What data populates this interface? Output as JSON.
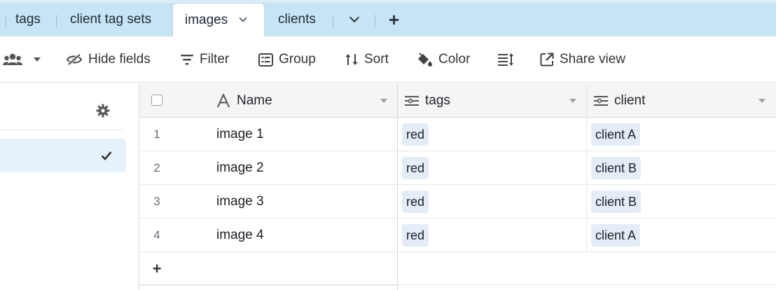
{
  "tabs": [
    {
      "label": "tags"
    },
    {
      "label": "client tag sets"
    },
    {
      "label": "images"
    },
    {
      "label": "clients"
    }
  ],
  "toolbar": {
    "collaborators_icon": "people-icon",
    "hide_fields": "Hide fields",
    "filter": "Filter",
    "group": "Group",
    "sort": "Sort",
    "color": "Color",
    "share_view": "Share view"
  },
  "grid": {
    "columns": [
      {
        "label": "Name",
        "icon": "text-field-icon"
      },
      {
        "label": "tags",
        "icon": "link-field-icon"
      },
      {
        "label": "client",
        "icon": "link-field-icon"
      }
    ],
    "rows": [
      {
        "num": "1",
        "name": "image 1",
        "tag": "red",
        "client": "client A"
      },
      {
        "num": "2",
        "name": "image 2",
        "tag": "red",
        "client": "client B"
      },
      {
        "num": "3",
        "name": "image 3",
        "tag": "red",
        "client": "client B"
      },
      {
        "num": "4",
        "name": "image 4",
        "tag": "red",
        "client": "client A"
      }
    ],
    "add_row": "+"
  },
  "tab_add": "+"
}
